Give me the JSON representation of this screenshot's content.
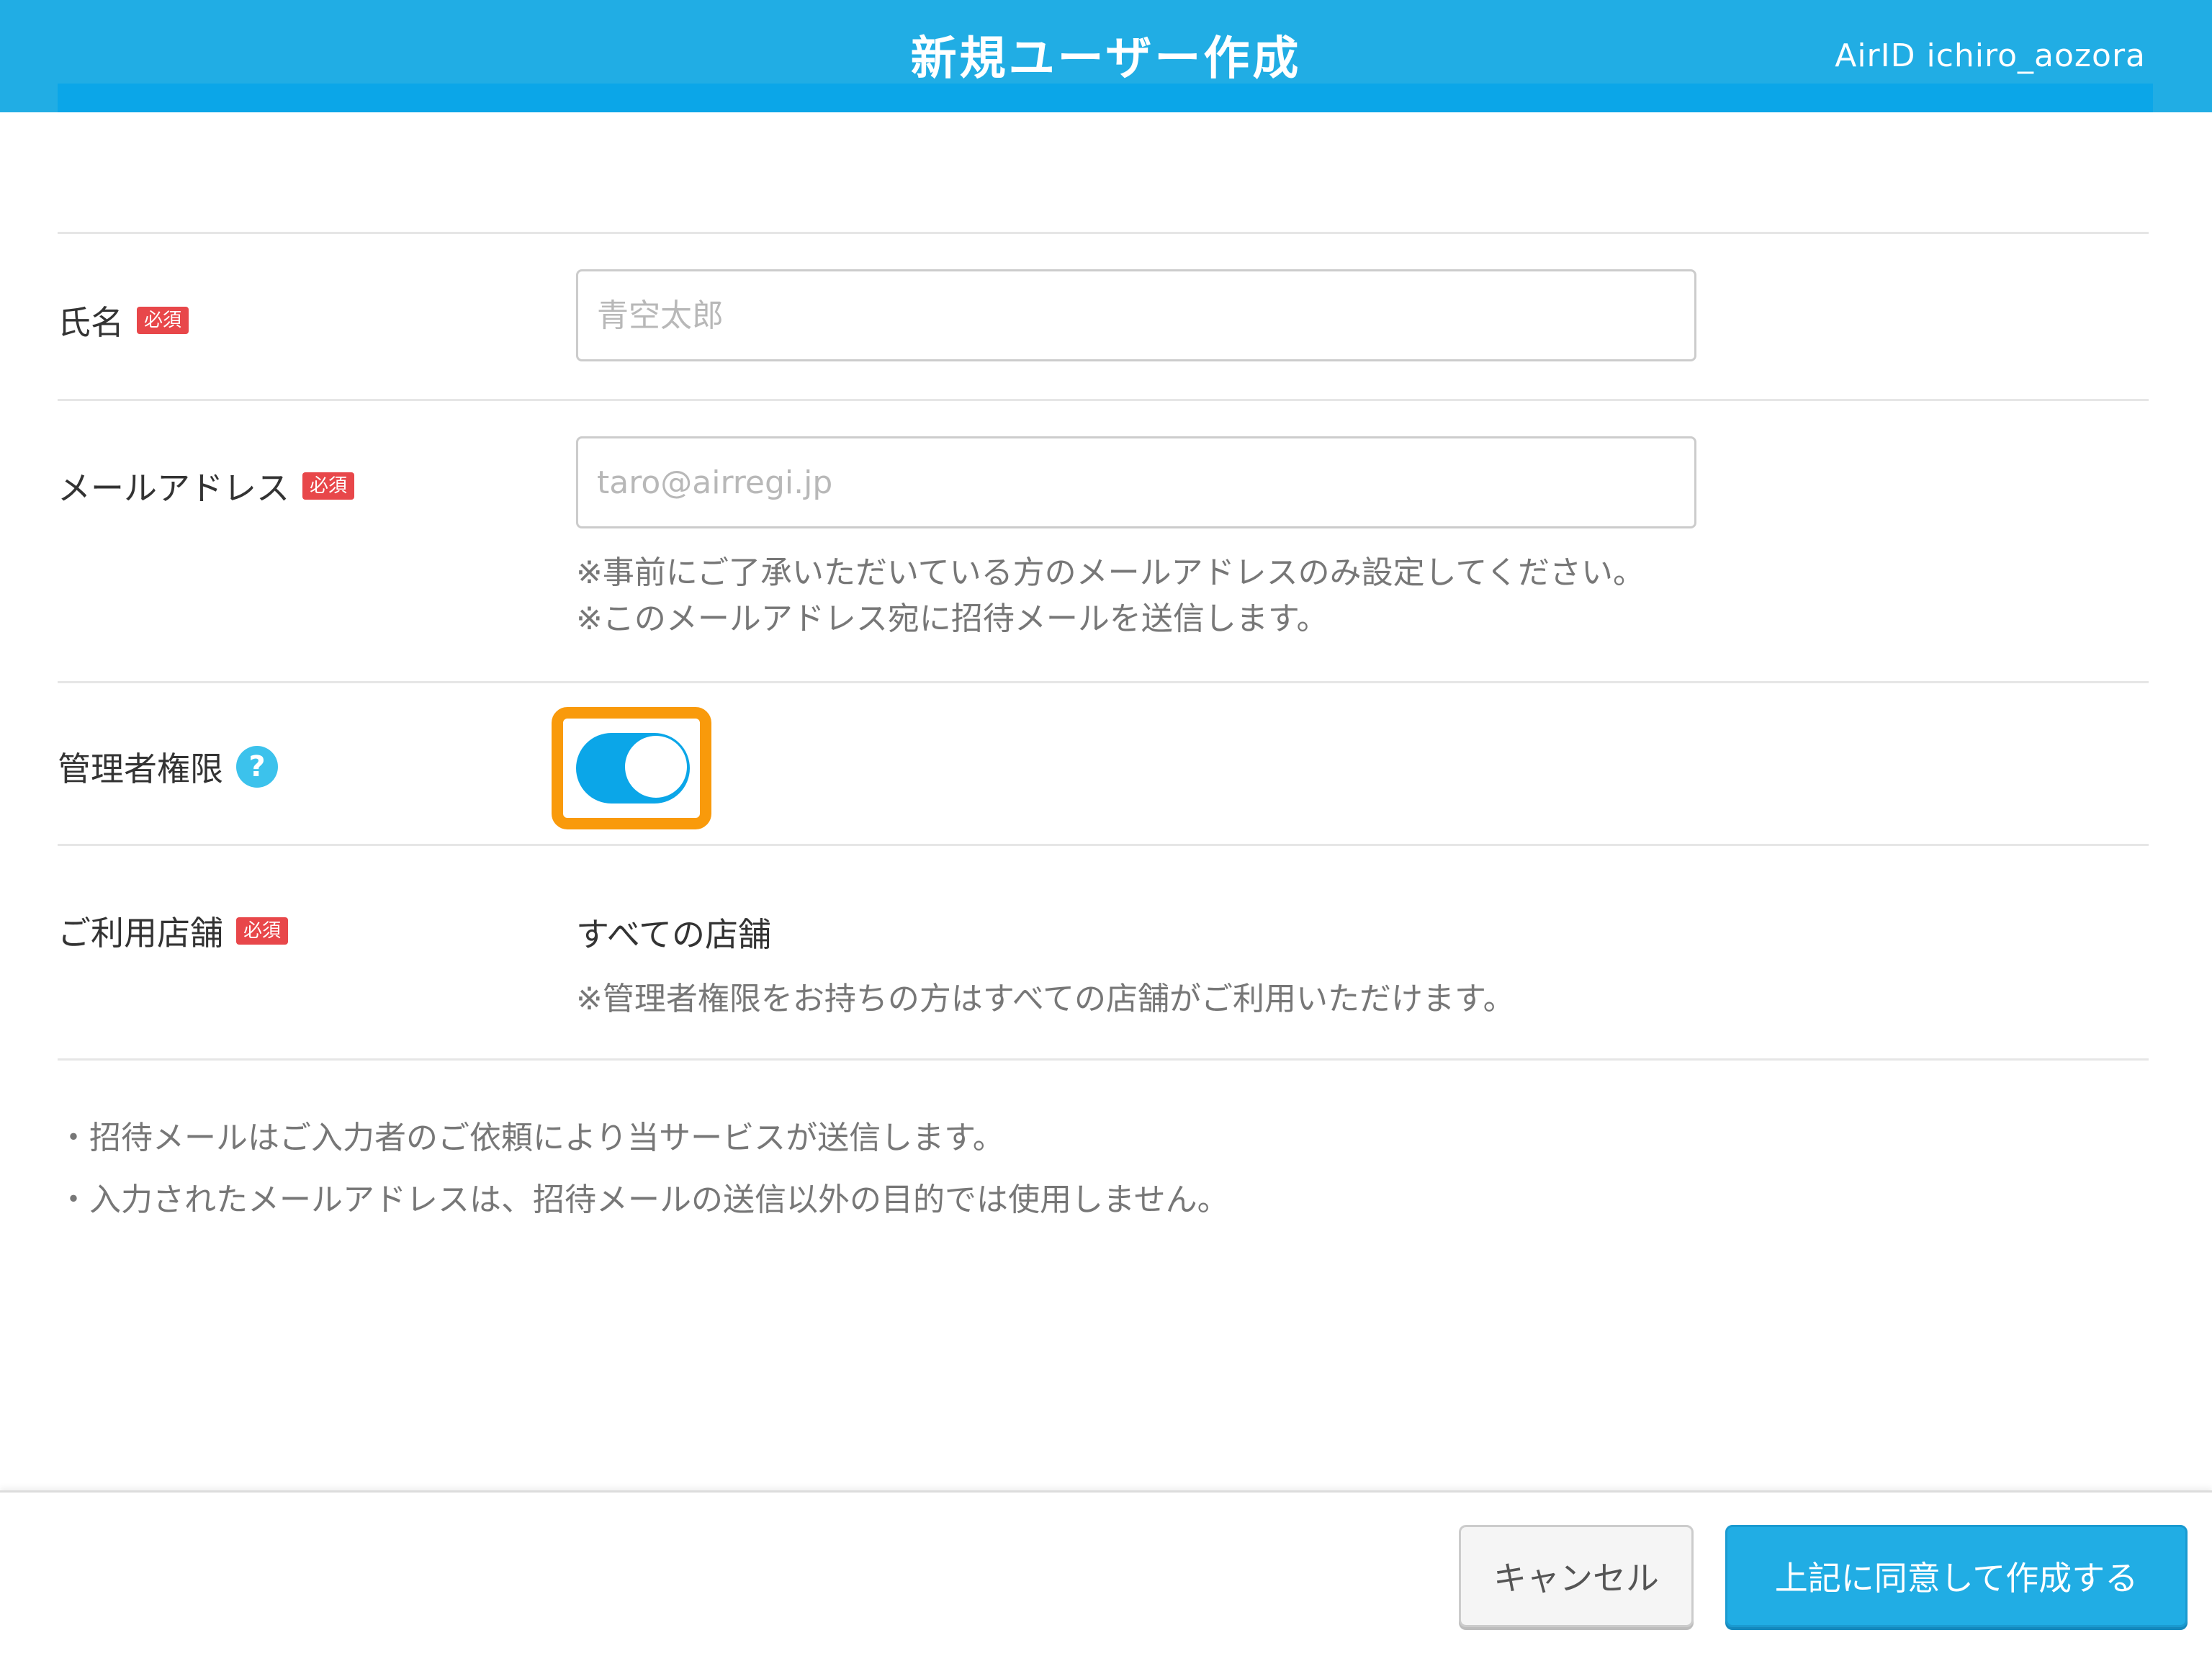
{
  "header": {
    "title": "新規ユーザー作成",
    "user": "AirID ichiro_aozora"
  },
  "form": {
    "name": {
      "label": "氏名",
      "required_badge": "必須",
      "placeholder": "青空太郎"
    },
    "email": {
      "label": "メールアドレス",
      "required_badge": "必須",
      "placeholder": "taro@airregi.jp",
      "notes": [
        "※事前にご了承いただいている方のメールアドレスのみ設定してください。",
        "※このメールアドレス宛に招待メールを送信します。"
      ]
    },
    "admin": {
      "label": "管理者権限",
      "help_icon": "?",
      "toggle_on": true
    },
    "stores": {
      "label": "ご利用店舗",
      "required_badge": "必須",
      "value": "すべての店舗",
      "note": "※管理者権限をお持ちの方はすべての店舗がご利用いただけます。"
    }
  },
  "disclaimers": [
    "・招待メールはご入力者のご依頼により当サービスが送信します。",
    "・入力されたメールアドレスは、招待メールの送信以外の目的では使用しません。"
  ],
  "footer": {
    "cancel_label": "キャンセル",
    "submit_label": "上記に同意して作成する"
  },
  "colors": {
    "header_bg": "#21ade4",
    "toggle_on": "#0ba6e8",
    "highlight": "#f99a0b",
    "required_badge": "#e8474a"
  }
}
